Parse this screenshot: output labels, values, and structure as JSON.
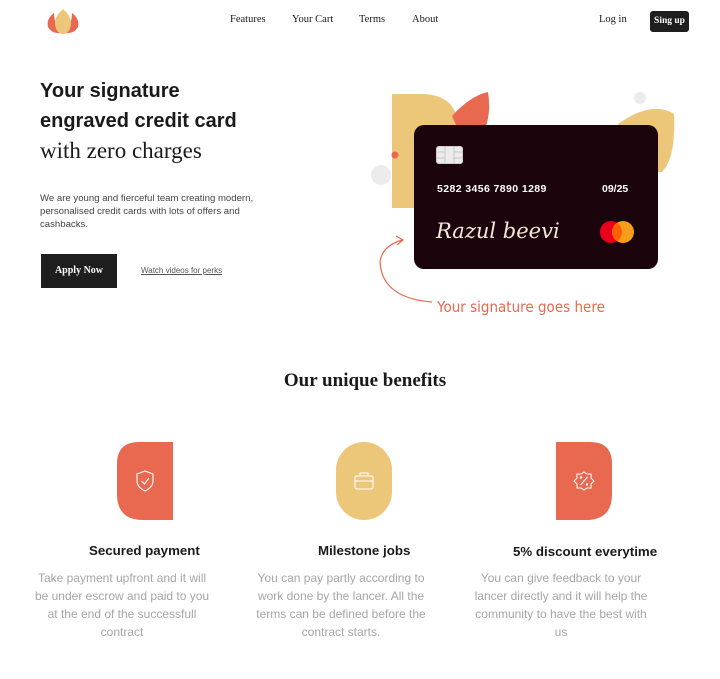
{
  "header": {
    "nav": [
      "Features",
      "Your Cart",
      "Terms",
      "About"
    ],
    "login": "Log in",
    "signup": "Sing up"
  },
  "hero": {
    "line1": "Your signature",
    "line2": "engraved credit card",
    "line3": "with zero charges",
    "description": "We are young and fierceful team creating modern, personalised credit cards with lots of offers and cashbacks.",
    "apply_label": "Apply Now",
    "video_link": "Watch videos for perks"
  },
  "card": {
    "number": "5282 3456 7890 1289",
    "expiry": "09/25",
    "signature": "Razul beevi",
    "caption": "Your signature goes here"
  },
  "benefits": {
    "title": "Our unique benefits",
    "items": [
      {
        "title": "Secured payment",
        "description": "Take payment upfront and it will be under escrow and paid to you at the end of the successfull contract",
        "icon": "shield-check-icon",
        "color": "#e8694f"
      },
      {
        "title": "Milestone jobs",
        "description": "You can pay partly according to work done by the lancer. All the terms can be defined before the contract starts.",
        "icon": "briefcase-icon",
        "color": "#ecc77a"
      },
      {
        "title": "5% discount everytime",
        "description": "You can give feedback to your lancer directly and it will help the community to have the best with us",
        "icon": "discount-badge-icon",
        "color": "#e8694f"
      }
    ]
  },
  "colors": {
    "accent": "#e8694f",
    "gold": "#ecc77a",
    "card_bg": "#1c040c",
    "button_dark": "#1e1e1e"
  }
}
